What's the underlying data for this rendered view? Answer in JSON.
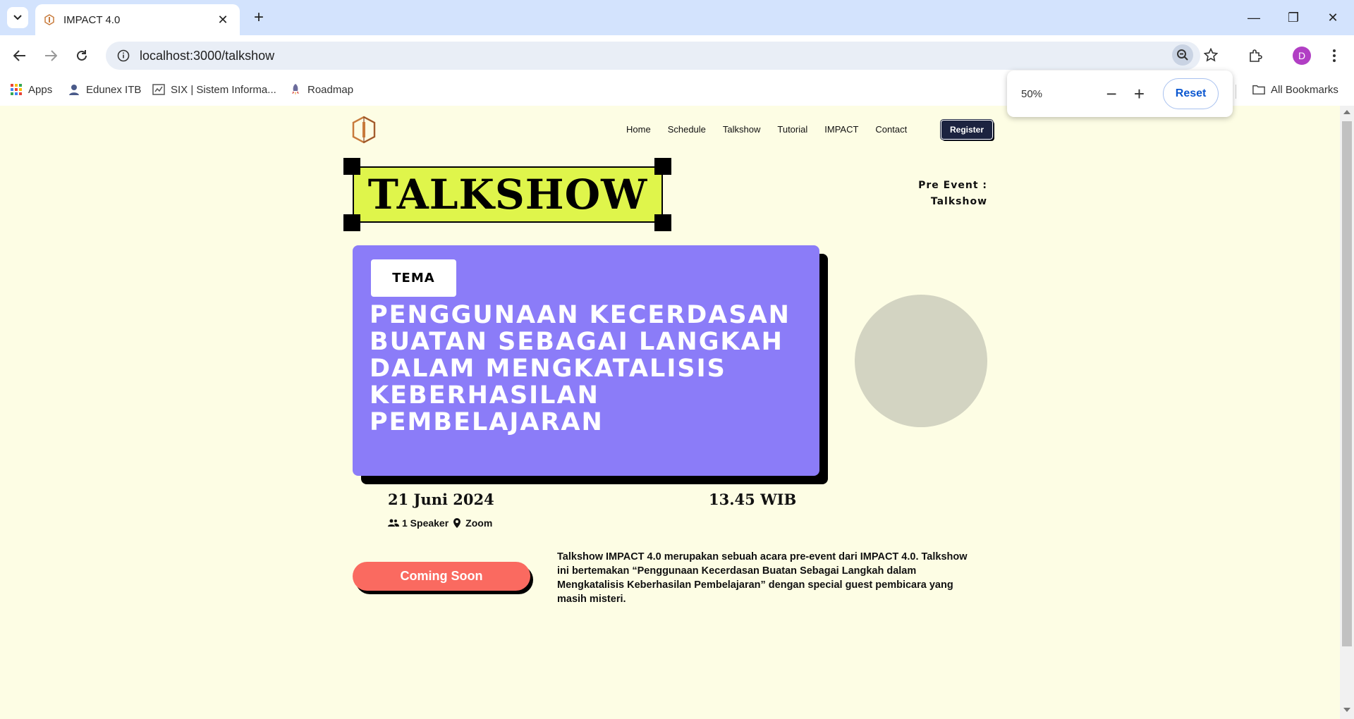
{
  "browser": {
    "tab_title": "IMPACT 4.0",
    "url": "localhost:3000/talkshow",
    "bookmarks": [
      "Apps",
      "Edunex ITB",
      "SIX | Sistem Informa...",
      "Roadmap"
    ],
    "all_bookmarks": "All Bookmarks",
    "profile_initial": "D",
    "zoom": {
      "level": "50%",
      "reset_label": "Reset"
    }
  },
  "site": {
    "nav": [
      "Home",
      "Schedule",
      "Talkshow",
      "Tutorial",
      "IMPACT",
      "Contact"
    ],
    "register_label": "Register",
    "page_title": "TALKSHOW",
    "pre_event_line1": "Pre Event :",
    "pre_event_line2": "Talkshow",
    "tema_label": "TEMA",
    "theme_title": "Penggunaan Kecerdasan Buatan Sebagai Langkah Dalam Mengkatalisis Keberhasilan Pembelajaran",
    "date": "21 Juni 2024",
    "time": "13.45 WIB",
    "speakers": "1 Speaker",
    "location": "Zoom",
    "cta_label": "Coming Soon",
    "description": "Talkshow IMPACT 4.0 merupakan sebuah acara pre-event dari IMPACT 4.0. Talkshow ini bertemakan “Penggunaan Kecerdasan Buatan Sebagai Langkah dalam Mengkatalisis Keberhasilan Pembelajaran” dengan special guest pembicara yang masih misteri."
  },
  "colors": {
    "page_bg": "#fdfde4",
    "title_highlight": "#dff54b",
    "theme_card": "#8b7cf8",
    "cta": "#fa6a60",
    "register_bg": "#1c2340",
    "speaker_placeholder": "#d3d4c2"
  }
}
